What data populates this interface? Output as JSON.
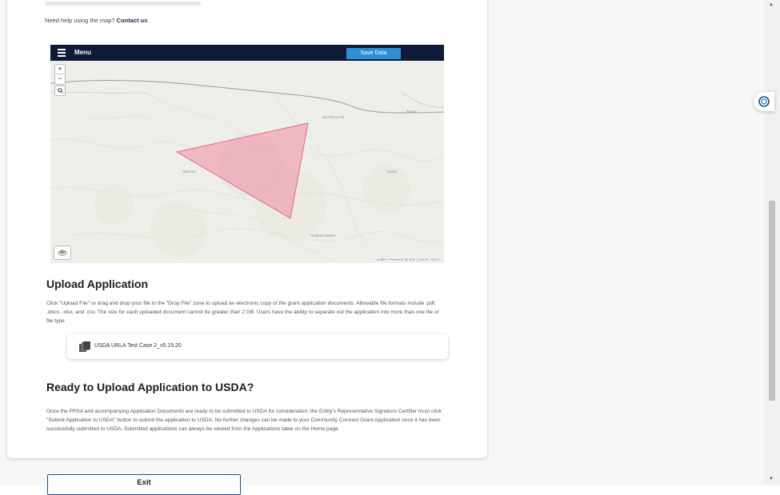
{
  "help": {
    "text": "Need help using the map?",
    "link": "Contact us"
  },
  "map": {
    "menu_label": "Menu",
    "save_button": "Save Data",
    "zoom_in": "+",
    "zoom_out": "−",
    "search_icon": "magnifier-icon",
    "layers_icon": "layers-icon",
    "attribution": "Leaflet | Powered by Esri | USGS, NOAA",
    "polygon_color": "#f08aa3",
    "labels": [
      "Sul Pecos Rd",
      "Tinnie",
      "Glencoe",
      "Hondo",
      "Ruidoso Downs"
    ]
  },
  "upload": {
    "title": "Upload Application",
    "description": "Click \"Upload File\" or drag and drop your file to the \"Drop File\" zone to upload an electronic copy of the grant application documents. Allowable file formats include .pdf, .docx, .xlsx, and .csv. The size for each uploaded document cannot be greater than 2 GB. Users have the ability to separate out the application into more than one file or file type.",
    "file_name": "USDA URLA Test Case 2_v5.15.20",
    "file_icon": "document-stack-icon"
  },
  "ready": {
    "title": "Ready to Upload Application to USDA?",
    "description": "Once the PPSA and accompanying Application Documents are ready to be submitted to USDA for consideration, the Entity's Representative Signature Certifier must click \"Submit Application to USDA\" button to submit the application to USDA. No further changes can be made to your Community Connect Grant Application once it has been successfully submitted to USDA. Submitted applications can always be viewed from the Applications table on the Home page."
  },
  "exit_label": "Exit",
  "colors": {
    "navy": "#0f1a3a",
    "accent": "#2d8fd5",
    "border": "#1d4f91"
  }
}
